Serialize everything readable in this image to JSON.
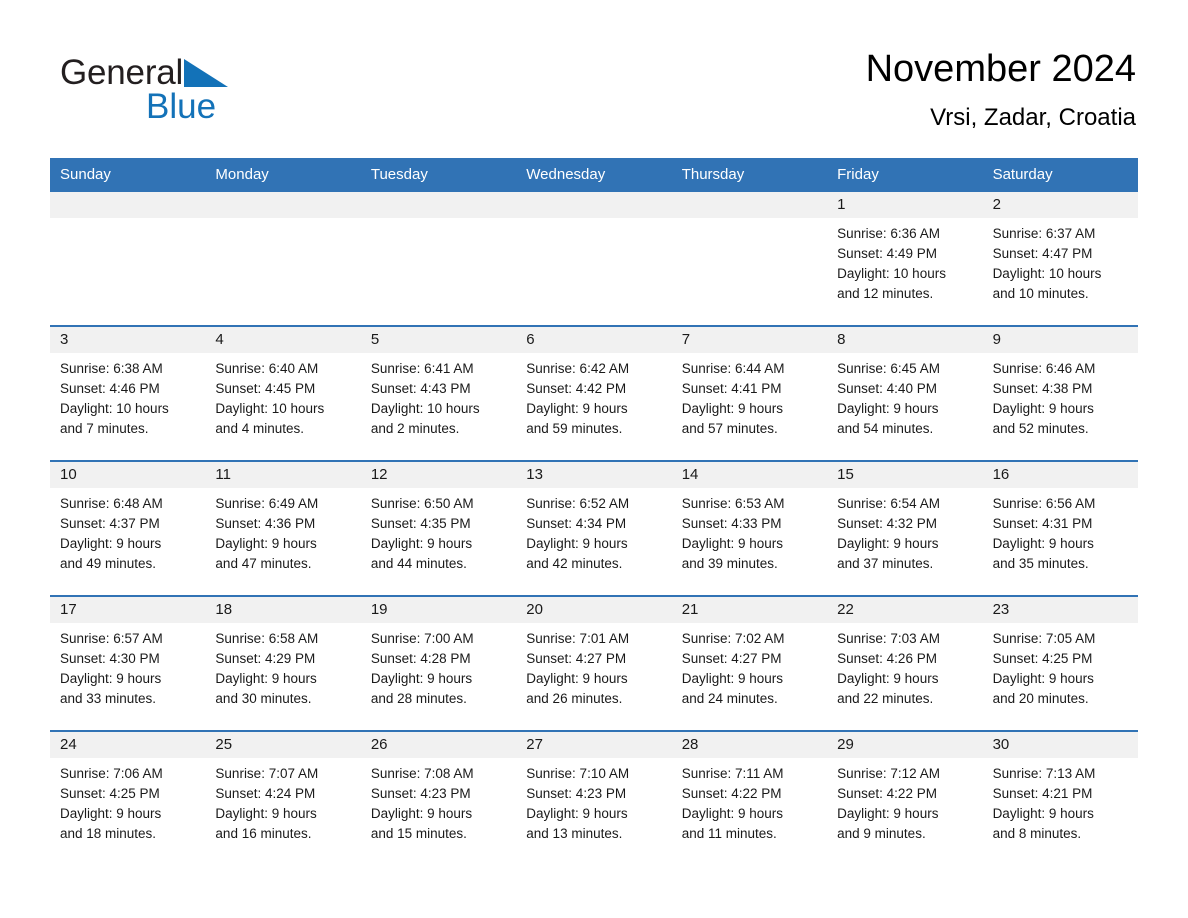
{
  "brand": {
    "name_part1": "General",
    "name_part2": "Blue",
    "logo_icon": "triangle-icon",
    "accent_color": "#1372b8"
  },
  "header": {
    "month_title": "November 2024",
    "location": "Vrsi, Zadar, Croatia"
  },
  "colors": {
    "header_blue": "#3173b5",
    "day_band_gray": "#f1f1f1",
    "text": "#1a1a1a"
  },
  "calendar": {
    "weekdays": [
      "Sunday",
      "Monday",
      "Tuesday",
      "Wednesday",
      "Thursday",
      "Friday",
      "Saturday"
    ],
    "weeks": [
      [
        {
          "day": "",
          "details": ""
        },
        {
          "day": "",
          "details": ""
        },
        {
          "day": "",
          "details": ""
        },
        {
          "day": "",
          "details": ""
        },
        {
          "day": "",
          "details": ""
        },
        {
          "day": "1",
          "details": "Sunrise: 6:36 AM\nSunset: 4:49 PM\nDaylight: 10 hours\nand 12 minutes."
        },
        {
          "day": "2",
          "details": "Sunrise: 6:37 AM\nSunset: 4:47 PM\nDaylight: 10 hours\nand 10 minutes."
        }
      ],
      [
        {
          "day": "3",
          "details": "Sunrise: 6:38 AM\nSunset: 4:46 PM\nDaylight: 10 hours\nand 7 minutes."
        },
        {
          "day": "4",
          "details": "Sunrise: 6:40 AM\nSunset: 4:45 PM\nDaylight: 10 hours\nand 4 minutes."
        },
        {
          "day": "5",
          "details": "Sunrise: 6:41 AM\nSunset: 4:43 PM\nDaylight: 10 hours\nand 2 minutes."
        },
        {
          "day": "6",
          "details": "Sunrise: 6:42 AM\nSunset: 4:42 PM\nDaylight: 9 hours\nand 59 minutes."
        },
        {
          "day": "7",
          "details": "Sunrise: 6:44 AM\nSunset: 4:41 PM\nDaylight: 9 hours\nand 57 minutes."
        },
        {
          "day": "8",
          "details": "Sunrise: 6:45 AM\nSunset: 4:40 PM\nDaylight: 9 hours\nand 54 minutes."
        },
        {
          "day": "9",
          "details": "Sunrise: 6:46 AM\nSunset: 4:38 PM\nDaylight: 9 hours\nand 52 minutes."
        }
      ],
      [
        {
          "day": "10",
          "details": "Sunrise: 6:48 AM\nSunset: 4:37 PM\nDaylight: 9 hours\nand 49 minutes."
        },
        {
          "day": "11",
          "details": "Sunrise: 6:49 AM\nSunset: 4:36 PM\nDaylight: 9 hours\nand 47 minutes."
        },
        {
          "day": "12",
          "details": "Sunrise: 6:50 AM\nSunset: 4:35 PM\nDaylight: 9 hours\nand 44 minutes."
        },
        {
          "day": "13",
          "details": "Sunrise: 6:52 AM\nSunset: 4:34 PM\nDaylight: 9 hours\nand 42 minutes."
        },
        {
          "day": "14",
          "details": "Sunrise: 6:53 AM\nSunset: 4:33 PM\nDaylight: 9 hours\nand 39 minutes."
        },
        {
          "day": "15",
          "details": "Sunrise: 6:54 AM\nSunset: 4:32 PM\nDaylight: 9 hours\nand 37 minutes."
        },
        {
          "day": "16",
          "details": "Sunrise: 6:56 AM\nSunset: 4:31 PM\nDaylight: 9 hours\nand 35 minutes."
        }
      ],
      [
        {
          "day": "17",
          "details": "Sunrise: 6:57 AM\nSunset: 4:30 PM\nDaylight: 9 hours\nand 33 minutes."
        },
        {
          "day": "18",
          "details": "Sunrise: 6:58 AM\nSunset: 4:29 PM\nDaylight: 9 hours\nand 30 minutes."
        },
        {
          "day": "19",
          "details": "Sunrise: 7:00 AM\nSunset: 4:28 PM\nDaylight: 9 hours\nand 28 minutes."
        },
        {
          "day": "20",
          "details": "Sunrise: 7:01 AM\nSunset: 4:27 PM\nDaylight: 9 hours\nand 26 minutes."
        },
        {
          "day": "21",
          "details": "Sunrise: 7:02 AM\nSunset: 4:27 PM\nDaylight: 9 hours\nand 24 minutes."
        },
        {
          "day": "22",
          "details": "Sunrise: 7:03 AM\nSunset: 4:26 PM\nDaylight: 9 hours\nand 22 minutes."
        },
        {
          "day": "23",
          "details": "Sunrise: 7:05 AM\nSunset: 4:25 PM\nDaylight: 9 hours\nand 20 minutes."
        }
      ],
      [
        {
          "day": "24",
          "details": "Sunrise: 7:06 AM\nSunset: 4:25 PM\nDaylight: 9 hours\nand 18 minutes."
        },
        {
          "day": "25",
          "details": "Sunrise: 7:07 AM\nSunset: 4:24 PM\nDaylight: 9 hours\nand 16 minutes."
        },
        {
          "day": "26",
          "details": "Sunrise: 7:08 AM\nSunset: 4:23 PM\nDaylight: 9 hours\nand 15 minutes."
        },
        {
          "day": "27",
          "details": "Sunrise: 7:10 AM\nSunset: 4:23 PM\nDaylight: 9 hours\nand 13 minutes."
        },
        {
          "day": "28",
          "details": "Sunrise: 7:11 AM\nSunset: 4:22 PM\nDaylight: 9 hours\nand 11 minutes."
        },
        {
          "day": "29",
          "details": "Sunrise: 7:12 AM\nSunset: 4:22 PM\nDaylight: 9 hours\nand 9 minutes."
        },
        {
          "day": "30",
          "details": "Sunrise: 7:13 AM\nSunset: 4:21 PM\nDaylight: 9 hours\nand 8 minutes."
        }
      ]
    ]
  }
}
